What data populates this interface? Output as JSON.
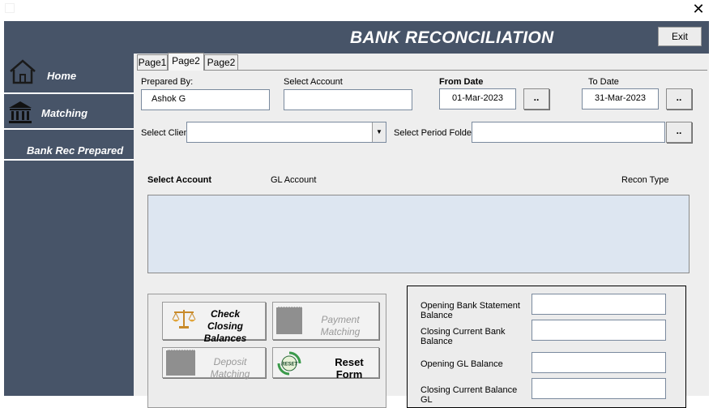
{
  "window": {
    "close_glyph": "✕"
  },
  "header": {
    "title": "BANK RECONCILIATION",
    "exit_label": "Exit"
  },
  "nav": [
    {
      "label": "Home",
      "icon": "home-icon"
    },
    {
      "label": "Matching",
      "icon": "bank-icon"
    },
    {
      "label": "Bank Rec Prepared",
      "icon": ""
    }
  ],
  "tabs": [
    {
      "label": "Page1",
      "active": false
    },
    {
      "label": "Page2",
      "active": true
    },
    {
      "label": "Page2",
      "active": false
    }
  ],
  "form": {
    "prepared_by_label": "Prepared By:",
    "prepared_by_value": "Ashok G",
    "select_account_label": "Select Account",
    "select_account_value": "",
    "from_date_label": "From Date",
    "from_date_value": "01-Mar-2023",
    "to_date_label": "To Date",
    "to_date_value": "31-Mar-2023",
    "dot_label": "..",
    "select_client_label": "Select Client",
    "select_client_value": "",
    "select_period_label": "Select Period Folder",
    "select_period_value": ""
  },
  "list": {
    "columns": [
      "Select Account",
      "GL Account",
      "Recon Type"
    ],
    "rows": []
  },
  "actions": {
    "check_closing": "Check Closing Balances",
    "payment_matching": "Payment Matching",
    "deposit_matching": "Deposit Matching",
    "reset_form": "Reset Form",
    "reset_icon_text": "RESET"
  },
  "balances": {
    "opening_bank": "Opening Bank Statement Balance",
    "closing_bank": "Closing Current Bank Balance",
    "opening_gl": "Opening GL Balance",
    "closing_gl": "Closing Current Balance GL"
  },
  "colors": {
    "nav_bg": "#475468",
    "content_bg": "#eeeeee",
    "list_bg": "#dde6f1"
  }
}
